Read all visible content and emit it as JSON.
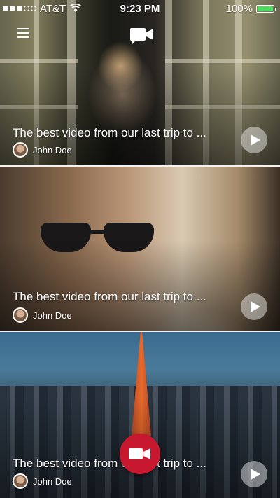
{
  "status_bar": {
    "carrier": "AT&T",
    "time": "9:23 PM",
    "battery": "100%",
    "battery_level": 1.0,
    "signal_bars_filled": 3,
    "signal_bars_total": 5
  },
  "header": {
    "menu_icon": "hamburger-menu-icon",
    "logo_icon": "video-camera-chat-icon"
  },
  "feed": [
    {
      "title": "The best video from our last trip to ...",
      "author": "John Doe"
    },
    {
      "title": "The best video from our last trip to ...",
      "author": "John Doe"
    },
    {
      "title": "The best video from our last trip to ...",
      "author": "John Doe"
    }
  ],
  "fab": {
    "icon": "video-camera-icon"
  },
  "colors": {
    "accent": "#c8182f",
    "battery": "#4cd964"
  }
}
